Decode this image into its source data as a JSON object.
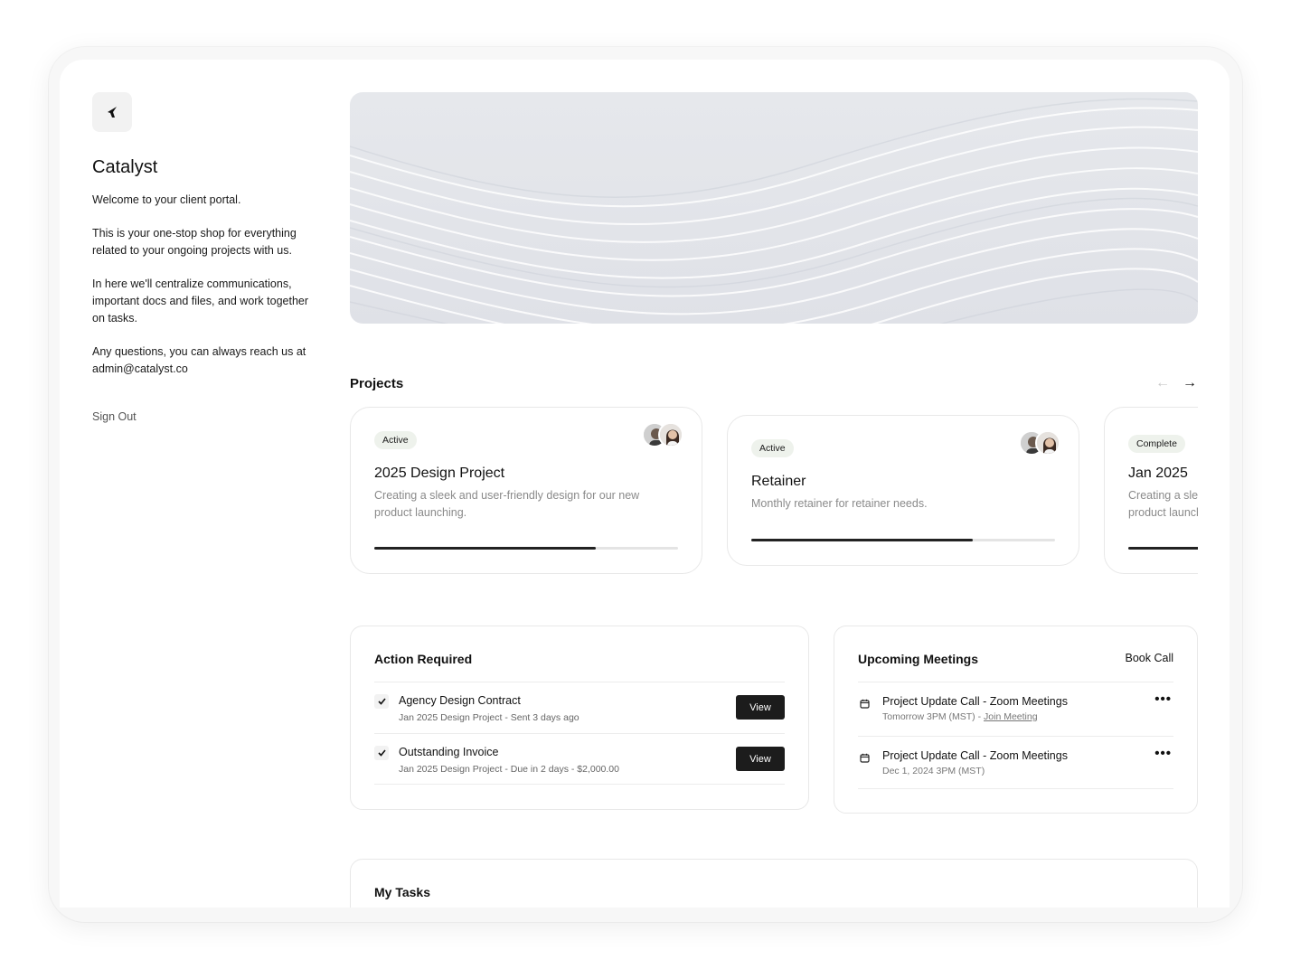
{
  "sidebar": {
    "logo_icon": "catalyst-logo-icon",
    "brand": "Catalyst",
    "intro": [
      "Welcome to your client portal.",
      "This is your one-stop shop for everything related to your ongoing projects with us.",
      "In here we'll centralize communications, important docs and files, and work together on tasks.",
      "Any questions, you can always reach us at admin@catalyst.co"
    ],
    "sign_out": "Sign Out"
  },
  "projects": {
    "title": "Projects",
    "prev_icon": "arrow-left-icon",
    "next_icon": "arrow-right-icon",
    "items": [
      {
        "badge": "Active",
        "title": "2025 Design Project",
        "description": "Creating a sleek and user-friendly design for our new product launching.",
        "progress": 0.73
      },
      {
        "badge": "Active",
        "title": "Retainer",
        "description": "Monthly retainer for retainer needs.",
        "progress": 0.73
      },
      {
        "badge": "Complete",
        "title": "Jan 2025",
        "description": "Creating a sleek and user-friendly design for our new product launching.",
        "progress": 1.0
      }
    ]
  },
  "action_required": {
    "title": "Action Required",
    "items": [
      {
        "title": "Agency Design Contract",
        "subtitle": "Jan 2025 Design Project - Sent 3 days ago",
        "button": "View"
      },
      {
        "title": "Outstanding Invoice",
        "subtitle": "Jan 2025 Design Project - Due in 2 days - $2,000.00",
        "button": "View"
      }
    ]
  },
  "meetings": {
    "title": "Upcoming Meetings",
    "book_call": "Book Call",
    "items": [
      {
        "title": "Project Update Call - Zoom Meetings",
        "subtitle": "Tomorrow 3PM (MST) - ",
        "link": "Join Meeting"
      },
      {
        "title": "Project Update Call - Zoom Meetings",
        "subtitle": "Dec 1, 2024 3PM (MST)",
        "link": ""
      }
    ]
  },
  "tasks": {
    "title": "My Tasks"
  }
}
